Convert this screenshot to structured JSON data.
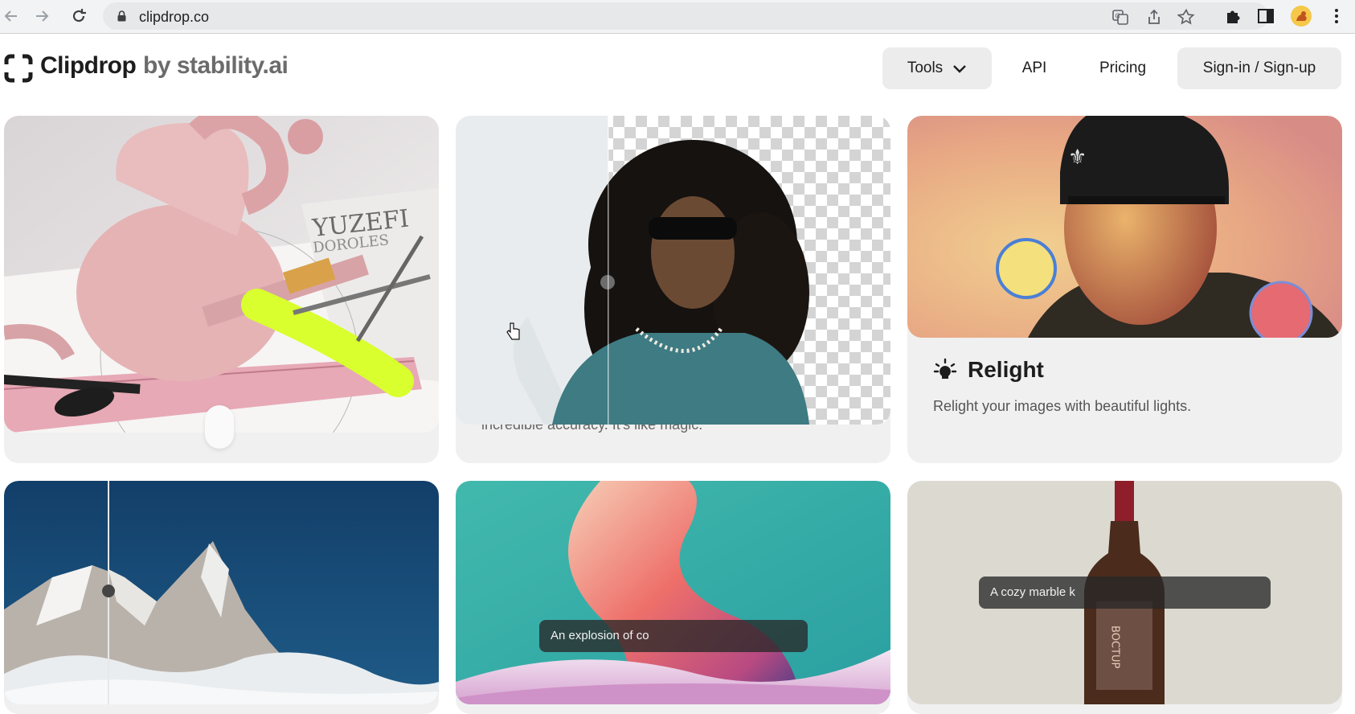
{
  "browser": {
    "url": "clipdrop.co",
    "icons": [
      "back-arrow-icon",
      "forward-arrow-icon",
      "reload-icon",
      "lock-icon",
      "translate-icon",
      "share-icon",
      "bookmark-star-icon",
      "extensions-puzzle-icon",
      "side-panel-icon",
      "profile-avatar-icon",
      "kebab-menu-icon"
    ]
  },
  "header": {
    "logo_main": "Clipdrop",
    "logo_sub": "by stability.ai",
    "nav": {
      "tools": "Tools",
      "api": "API",
      "pricing": "Pricing",
      "signin": "Sign-in / Sign-up"
    }
  },
  "cards": {
    "cleanup": {
      "image": "pink-handbag-cleanup-demo"
    },
    "remove_bg": {
      "image": "curly-hair-man-background-removal-demo",
      "desc_partial": "incredible accuracy. It's like magic."
    },
    "relight": {
      "title": "Relight",
      "desc": "Relight your images with beautiful lights.",
      "image": "man-in-beanie-relight-demo"
    },
    "upscale": {
      "image": "snowy-mountain-peak-comparison-demo"
    },
    "sdxl": {
      "image": "abstract-gradient-shape-demo",
      "prompt": "An explosion of co"
    },
    "replace_bg": {
      "image": "wine-bottle-demo",
      "prompt": "A cozy marble k"
    }
  },
  "colors": {
    "header_bg": "#ffffff",
    "card_bg": "#f0f0f0",
    "button_gray": "#ececec",
    "text_dark": "#1d1d1d"
  }
}
